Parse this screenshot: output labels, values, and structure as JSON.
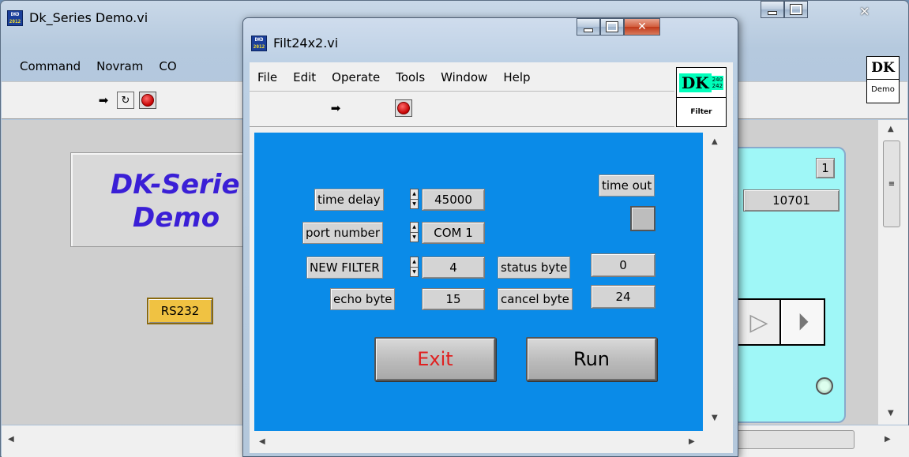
{
  "bg_window": {
    "title": "Dk_Series Demo.vi",
    "menus": [
      "Command",
      "Novram",
      "CO"
    ],
    "heading_line1": "DK-Serie",
    "heading_line2": "Demo",
    "rs232_label": "RS232",
    "counter_value": "10701",
    "page_index": "1",
    "logo_top": "DK",
    "logo_bottom": "Demo"
  },
  "dialog": {
    "title": "Filt24x2.vi",
    "menus": [
      "File",
      "Edit",
      "Operate",
      "Tools",
      "Window",
      "Help"
    ],
    "logo_top": "DK",
    "logo_nums": "240\n242",
    "logo_bottom": "Filter",
    "controls": {
      "time_delay": {
        "label": "time delay",
        "value": "45000"
      },
      "port_number": {
        "label": "port number",
        "value": "COM 1"
      },
      "new_filter": {
        "label": "NEW FILTER",
        "value": "4"
      },
      "echo_byte": {
        "label": "echo  byte",
        "value": "15"
      },
      "status_byte": {
        "label": "status byte",
        "value": "0"
      },
      "cancel_byte": {
        "label": "cancel byte",
        "value": "24"
      },
      "time_out": {
        "label": "time out"
      }
    },
    "exit_label": "Exit",
    "run_label": "Run"
  },
  "colors": {
    "panel_blue": "#0a8be8",
    "heading_blue": "#3a1fd6",
    "exit_red": "#e02020",
    "cyan_panel": "#9ff7f7",
    "rs232_bg": "#f0c242"
  },
  "icons": [
    "run-arrow-icon",
    "run-continuous-icon",
    "abort-stop-icon",
    "labview-app-icon"
  ]
}
